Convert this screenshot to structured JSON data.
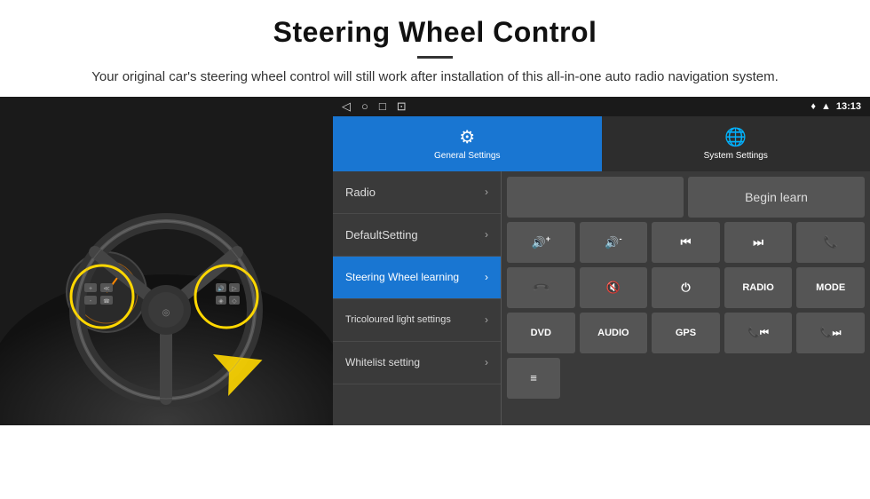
{
  "header": {
    "title": "Steering Wheel Control",
    "subtitle": "Your original car's steering wheel control will still work after installation of this all-in-one auto radio navigation system."
  },
  "status_bar": {
    "nav_icons": [
      "◁",
      "○",
      "□",
      "⊡"
    ],
    "time": "13:13",
    "signal_icon": "signal",
    "wifi_icon": "wifi"
  },
  "tabs": [
    {
      "label": "General Settings",
      "active": true
    },
    {
      "label": "System Settings",
      "active": false
    }
  ],
  "menu": {
    "items": [
      {
        "label": "Radio",
        "active": false
      },
      {
        "label": "DefaultSetting",
        "active": false
      },
      {
        "label": "Steering Wheel learning",
        "active": true
      },
      {
        "label": "Tricoloured light settings",
        "active": false
      },
      {
        "label": "Whitelist setting",
        "active": false
      }
    ]
  },
  "controls": {
    "begin_learn_label": "Begin learn",
    "rows": [
      [
        {
          "type": "icon",
          "label": "🔊+",
          "sym": "🔊+"
        },
        {
          "type": "icon",
          "label": "🔊-",
          "sym": "🔊-"
        },
        {
          "type": "icon",
          "label": "⏮",
          "sym": "⏮"
        },
        {
          "type": "icon",
          "label": "⏭",
          "sym": "⏭"
        },
        {
          "type": "icon",
          "label": "☎",
          "sym": "☎"
        }
      ],
      [
        {
          "type": "icon",
          "label": "↩",
          "sym": "↩"
        },
        {
          "type": "icon",
          "label": "🔇×",
          "sym": "🔇×"
        },
        {
          "type": "icon",
          "label": "⏻",
          "sym": "⏻"
        },
        {
          "type": "text",
          "label": "RADIO"
        },
        {
          "type": "text",
          "label": "MODE"
        }
      ],
      [
        {
          "type": "text",
          "label": "DVD"
        },
        {
          "type": "text",
          "label": "AUDIO"
        },
        {
          "type": "text",
          "label": "GPS"
        },
        {
          "type": "icon",
          "label": "☎⏮",
          "sym": "☎⏮"
        },
        {
          "type": "icon",
          "label": "☎⏭",
          "sym": "☎⏭"
        }
      ],
      [
        {
          "type": "icon",
          "label": "≡",
          "sym": "≡"
        }
      ]
    ]
  }
}
